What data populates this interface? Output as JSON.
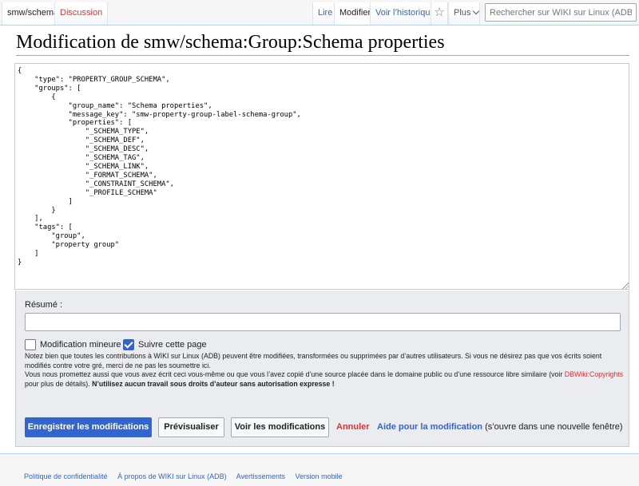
{
  "tabs": {
    "namespace": "smw/schema",
    "talk": "Discussion",
    "read": "Lire",
    "edit": "Modifier",
    "history": "Voir l’historique",
    "watch_icon": "☆",
    "more": "Plus"
  },
  "search": {
    "placeholder": "Rechercher sur WIKI sur Linux (ADB)"
  },
  "page": {
    "title": "Modification de smw/schema:Group:Schema properties"
  },
  "editor": {
    "content": "{\n    \"type\": \"PROPERTY_GROUP_SCHEMA\",\n    \"groups\": [\n        {\n            \"group_name\": \"Schema properties\",\n            \"message_key\": \"smw-property-group-label-schema-group\",\n            \"properties\": [\n                \"_SCHEMA_TYPE\",\n                \"_SCHEMA_DEF\",\n                \"_SCHEMA_DESC\",\n                \"_SCHEMA_TAG\",\n                \"_SCHEMA_LINK\",\n                \"_FORMAT_SCHEMA\",\n                \"_CONSTRAINT_SCHEMA\",\n                \"_PROFILE_SCHEMA\"\n            ]\n        }\n    ],\n    \"tags\": [\n        \"group\",\n        \"property group\"\n    ]\n}"
  },
  "options": {
    "summary_label": "Résumé :",
    "summary_value": "",
    "minor_label": "Modification mineure",
    "minor_checked": false,
    "watch_label": "Suivre cette page",
    "watch_checked": true,
    "notice_1": "Notez bien que toutes les contributions à WIKI sur Linux (ADB) peuvent être modifiées, transformées ou supprimées par d’autres utilisateurs. Si vous ne désirez pas que vos écrits soient modifiés contre votre gré, merci de ne pas les soumettre ici.",
    "notice_2a": "Vous nous promettez aussi que vous avez écrit ceci vous-même ou que vous l’avez copié d’une source placée dans le domaine public ou d’une ressource libre similaire (voir ",
    "notice_link": "DBWiki:Copyrights",
    "notice_2b": " pour plus de détails). ",
    "notice_bold": "N’utilisez aucun travail sous droits d’auteur sans autorisation expresse !"
  },
  "buttons": {
    "save": "Enregistrer les modifications",
    "preview": "Prévisualiser",
    "diff": "Voir les modifications",
    "cancel": "Annuler",
    "help": "Aide pour la modification",
    "help_note": " (s’ouvre dans une nouvelle fenêtre)"
  },
  "footer": {
    "privacy": "Politique de confidentialité",
    "about": "À propos de WIKI sur Linux (ADB)",
    "disclaimers": "Avertissements",
    "mobile": "Version mobile"
  },
  "colors": {
    "accent": "#3366cc",
    "red_link": "#dd3333"
  }
}
